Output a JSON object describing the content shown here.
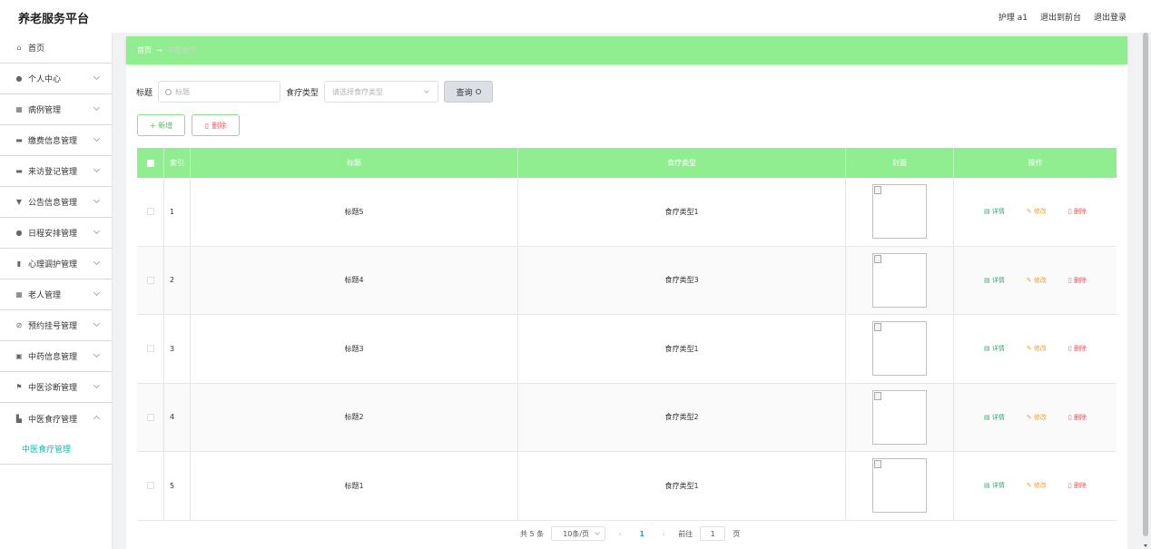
{
  "app": {
    "title": "养老服务平台"
  },
  "header": {
    "user": "护理 a1",
    "link_front": "退出到前台",
    "link_logout": "退出登录"
  },
  "sidebar": {
    "items": [
      {
        "label": "首页",
        "icon": "home-icon"
      },
      {
        "label": "个人中心",
        "icon": "user-icon"
      },
      {
        "label": "病例管理",
        "icon": "grid-icon"
      },
      {
        "label": "缴费信息管理",
        "icon": "monitor-icon"
      },
      {
        "label": "来访登记管理",
        "icon": "ticket-icon"
      },
      {
        "label": "公告信息管理",
        "icon": "message-icon"
      },
      {
        "label": "日程安排管理",
        "icon": "user-icon"
      },
      {
        "label": "心理调护管理",
        "icon": "chart-icon"
      },
      {
        "label": "老人管理",
        "icon": "apps-icon"
      },
      {
        "label": "预约挂号管理",
        "icon": "bell-off-icon"
      },
      {
        "label": "中药信息管理",
        "icon": "clipboard-icon"
      },
      {
        "label": "中医诊断管理",
        "icon": "flag-icon"
      },
      {
        "label": "中医食疗管理",
        "icon": "book-icon"
      }
    ],
    "sub_item": "中医食疗管理"
  },
  "breadcrumb": {
    "home": "首页",
    "arrow": "→",
    "current": "中医食疗"
  },
  "search": {
    "title_label": "标题",
    "title_placeholder": "标题",
    "type_label": "食疗类型",
    "type_placeholder": "请选择食疗类型",
    "query_button": "查询"
  },
  "actions": {
    "add": "+ 新增",
    "delete": "删除"
  },
  "table": {
    "columns": [
      "索引",
      "标题",
      "食疗类型",
      "封面",
      "操作"
    ],
    "rows": [
      {
        "index": "1",
        "title": "标题5",
        "type": "食疗类型1"
      },
      {
        "index": "2",
        "title": "标题4",
        "type": "食疗类型3"
      },
      {
        "index": "3",
        "title": "标题3",
        "type": "食疗类型1"
      },
      {
        "index": "4",
        "title": "标题2",
        "type": "食疗类型2"
      },
      {
        "index": "5",
        "title": "标题1",
        "type": "食疗类型1"
      }
    ],
    "op_detail": "详情",
    "op_edit": "修改",
    "op_delete": "删除"
  },
  "pager": {
    "total": "共 5 条",
    "page_size": "10条/页",
    "prev": "‹",
    "current": "1",
    "next": "›",
    "goto": "前往",
    "goto_value": "1",
    "page_suffix": "页"
  },
  "colors": {
    "accent": "#90ee90",
    "active": "#1db5a2"
  }
}
